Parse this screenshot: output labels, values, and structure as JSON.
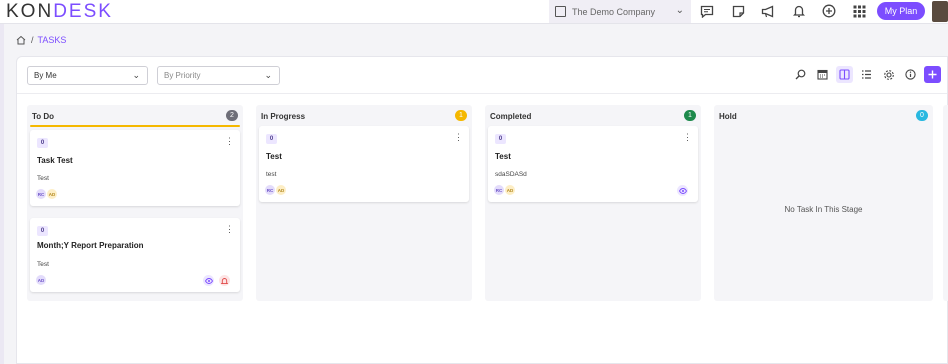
{
  "brand": {
    "prefix": "KON",
    "accent": "DESK"
  },
  "header": {
    "company": "The Demo Company",
    "my_plan": "My Plan"
  },
  "breadcrumb": {
    "separator": "/",
    "current": "TASKS"
  },
  "filters": {
    "assignee": "By Me",
    "priority_placeholder": "By Priority"
  },
  "columns": [
    {
      "name": "To Do",
      "count": "2",
      "color": "#6e6e78",
      "bar": "#f5b800"
    },
    {
      "name": "In Progress",
      "count": "1",
      "color": "#f5b800"
    },
    {
      "name": "Completed",
      "count": "1",
      "color": "#1e8a4c"
    },
    {
      "name": "Hold",
      "count": "0",
      "color": "#29b8e0",
      "empty": "No Task In This Stage"
    }
  ],
  "cards": {
    "todo_1": {
      "badge": "0",
      "title": "Task Test",
      "desc": "Test",
      "avatars": [
        "RC",
        "AD"
      ]
    },
    "todo_2": {
      "badge": "0",
      "title": "Month;Y Report Preparation",
      "desc": "Test",
      "avatars": [
        "AD"
      ]
    },
    "progress_1": {
      "badge": "0",
      "title": "Test",
      "desc": "test",
      "avatars": [
        "RC",
        "AD"
      ]
    },
    "completed_1": {
      "badge": "0",
      "title": "Test",
      "desc": "sdaSDASd",
      "avatars": [
        "RC",
        "AD"
      ]
    }
  },
  "colors": {
    "accent": "#7c4dff"
  }
}
